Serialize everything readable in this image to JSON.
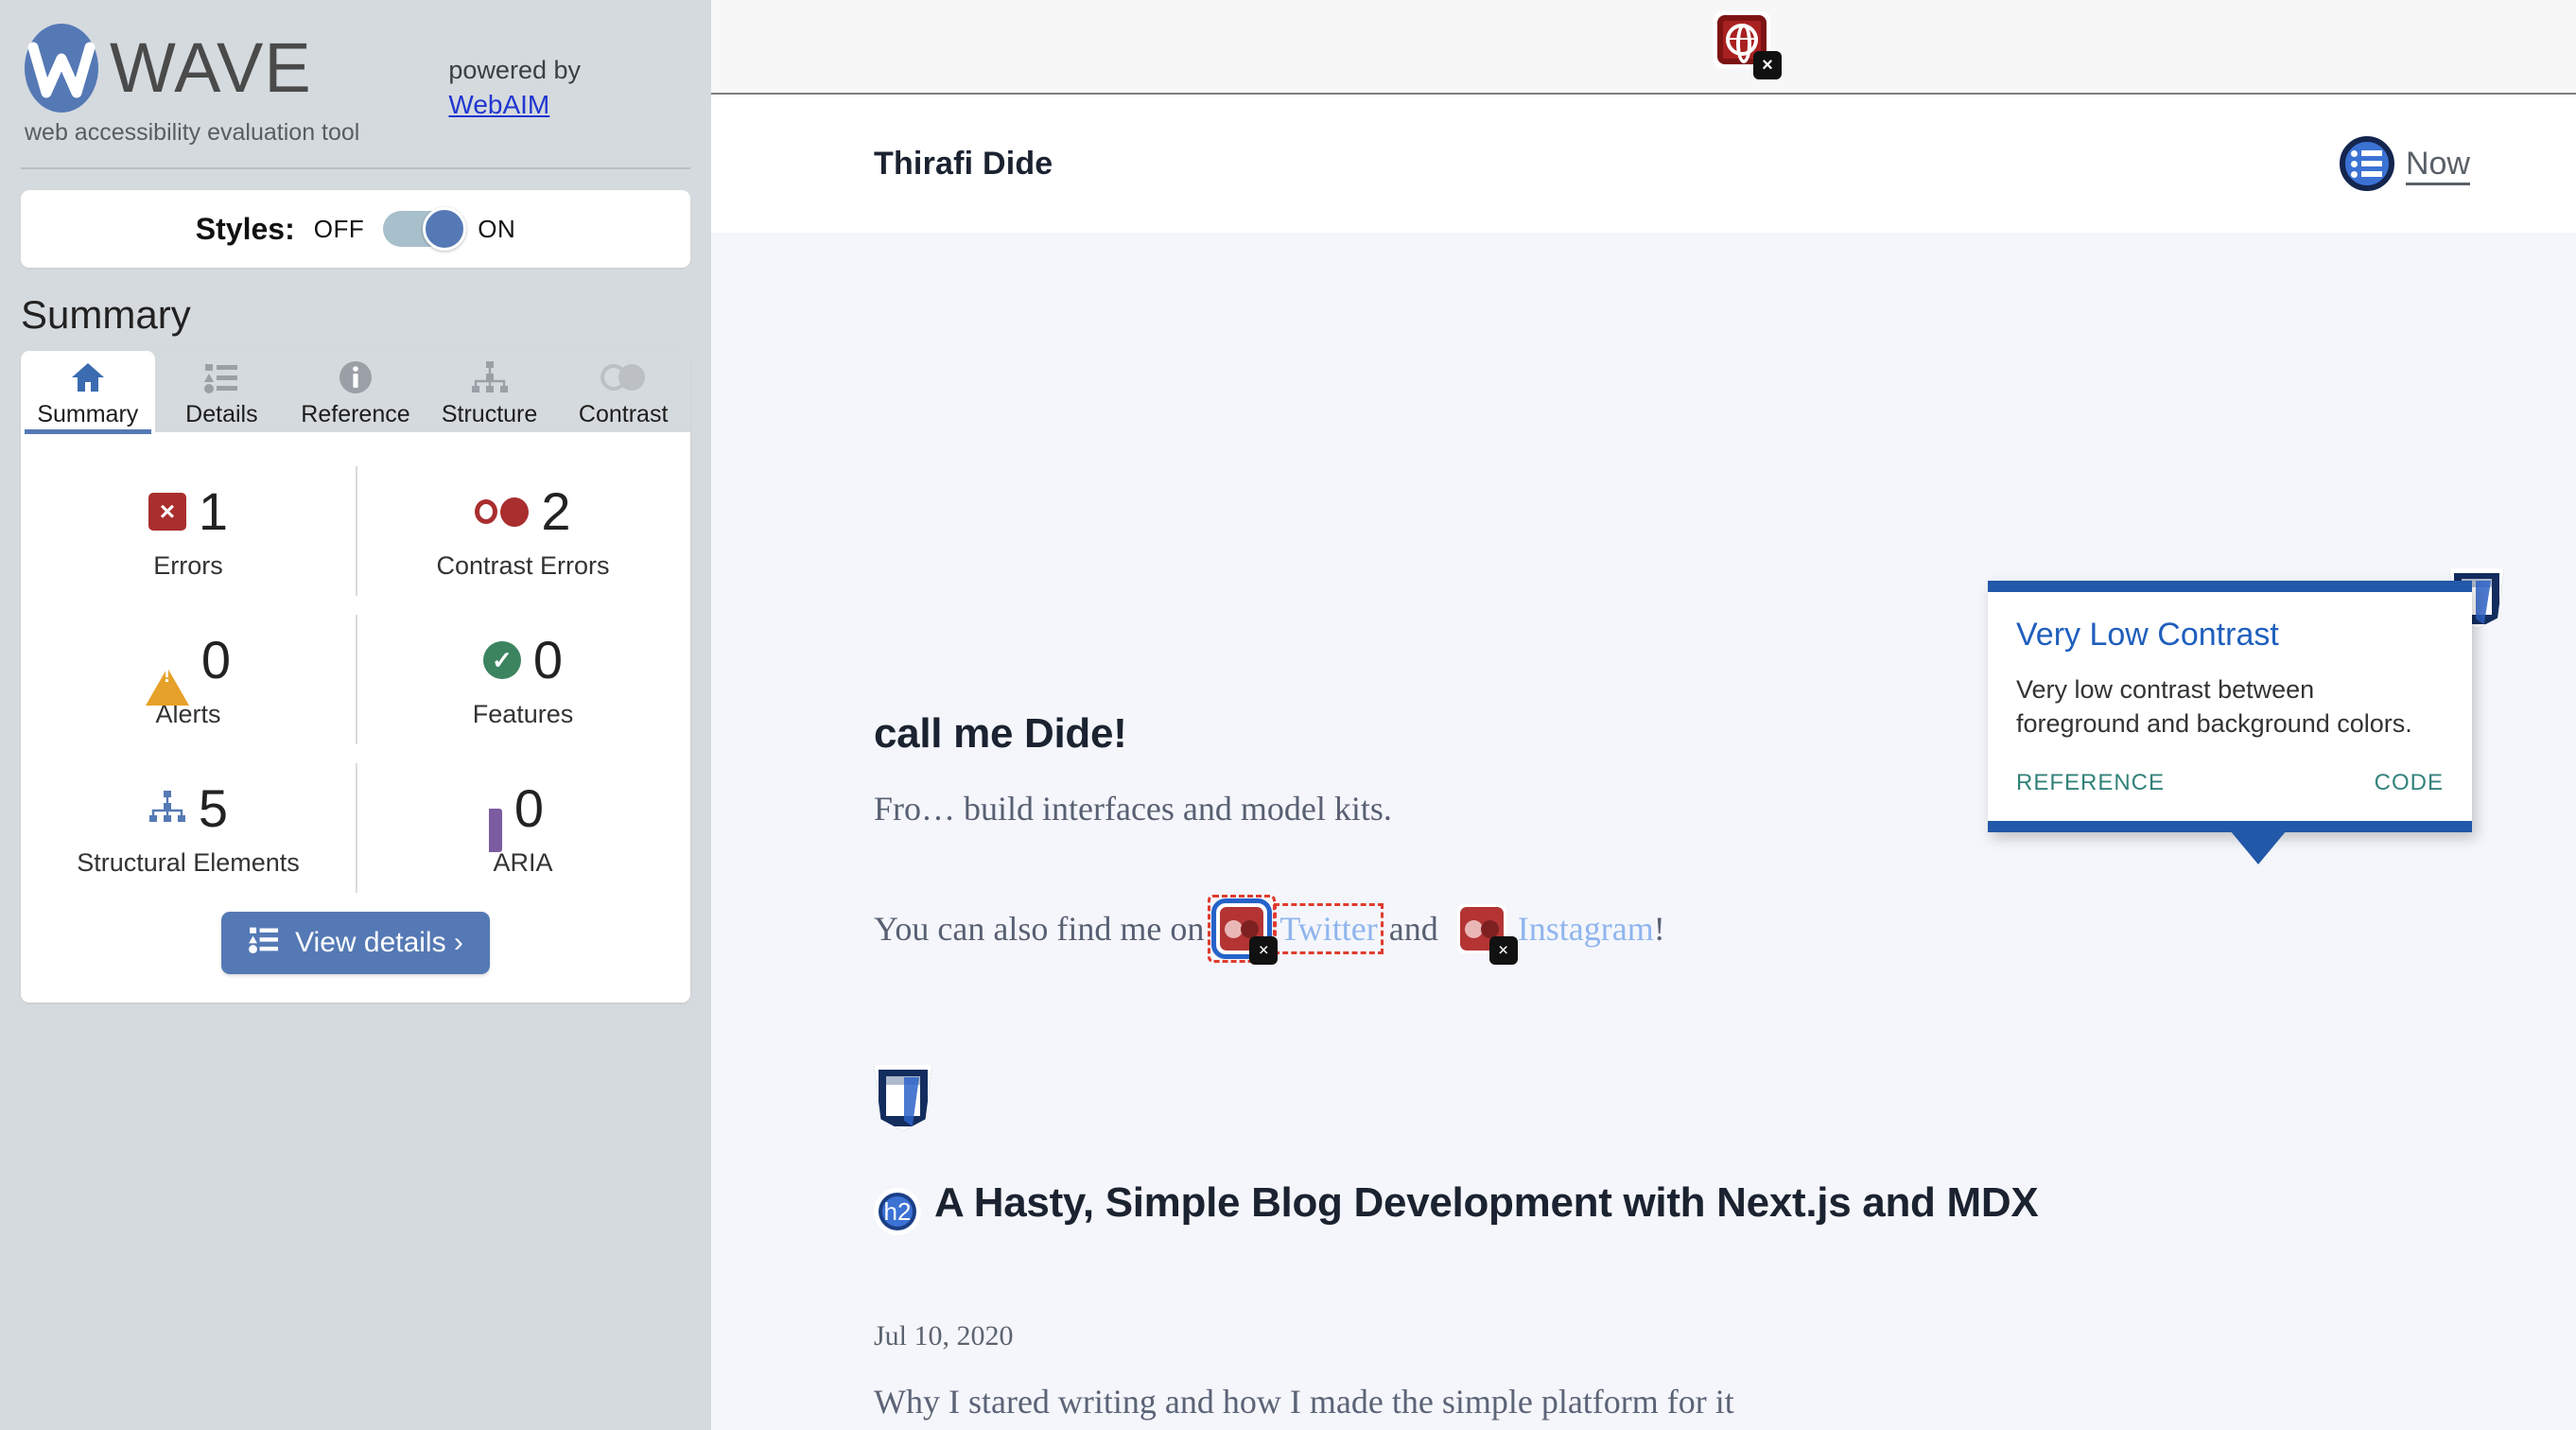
{
  "sidebar": {
    "brand": {
      "wordmark": "WAVE",
      "tagline": "web accessibility evaluation tool",
      "logo_icon": "wave-logo-icon",
      "powered_by": "powered by",
      "powered_link": "WebAIM"
    },
    "styles": {
      "label": "Styles:",
      "off": "OFF",
      "on": "ON",
      "state": "ON"
    },
    "summary_title": "Summary",
    "tabs": [
      {
        "label": "Summary",
        "icon": "home-icon",
        "active": true
      },
      {
        "label": "Details",
        "icon": "list-icon",
        "active": false
      },
      {
        "label": "Reference",
        "icon": "info-icon",
        "active": false
      },
      {
        "label": "Structure",
        "icon": "structure-icon",
        "active": false
      },
      {
        "label": "Contrast",
        "icon": "contrast-icon",
        "active": false
      }
    ],
    "stats": [
      {
        "value": "1",
        "label": "Errors",
        "icon": "error-icon"
      },
      {
        "value": "2",
        "label": "Contrast Errors",
        "icon": "contrast-error-icon"
      },
      {
        "value": "0",
        "label": "Alerts",
        "icon": "alert-icon"
      },
      {
        "value": "0",
        "label": "Features",
        "icon": "feature-check-icon"
      },
      {
        "value": "5",
        "label": "Structural Elements",
        "icon": "structure-icon"
      },
      {
        "value": "0",
        "label": "ARIA",
        "icon": "aria-cube-icon"
      }
    ],
    "view_details": "View details ›",
    "view_details_icon": "list-icon"
  },
  "browser": {
    "page_error_icon": "globe-error-icon"
  },
  "page": {
    "site_title": "Thirafi Dide",
    "nav": {
      "now_label": "Now",
      "now_icon": "list-circle-icon"
    },
    "heading1": "call me Dide!",
    "intro_paragraph_visible": "Fro… build interfaces and model kits.",
    "social": {
      "prefix": "You can also find me on",
      "twitter": "Twitter",
      "conjunction": "and",
      "instagram": "Instagram",
      "suffix": "!"
    },
    "article": {
      "structural_icon": "region-shield-icon",
      "h2_badge": "h2",
      "title": "A Hasty, Simple Blog Development with Next.js and MDX",
      "date": "Jul 10, 2020",
      "description": "Why I stared writing and how I made the simple platform for it"
    }
  },
  "tooltip": {
    "title": "Very Low Contrast",
    "body": "Very low contrast between foreground and background colors.",
    "reference": "REFERENCE",
    "code": "CODE"
  },
  "colors": {
    "accent_blue": "#5579b5",
    "tooltip_border": "#2258a8",
    "tooltip_title": "#1f5fbd",
    "error_red": "#a92e2e",
    "alert_orange": "#e5a129",
    "feature_green": "#3c8460",
    "aria_purple": "#4d2a76",
    "sidebar_bg": "#d5dade",
    "page_bg": "#f4f6fb"
  }
}
